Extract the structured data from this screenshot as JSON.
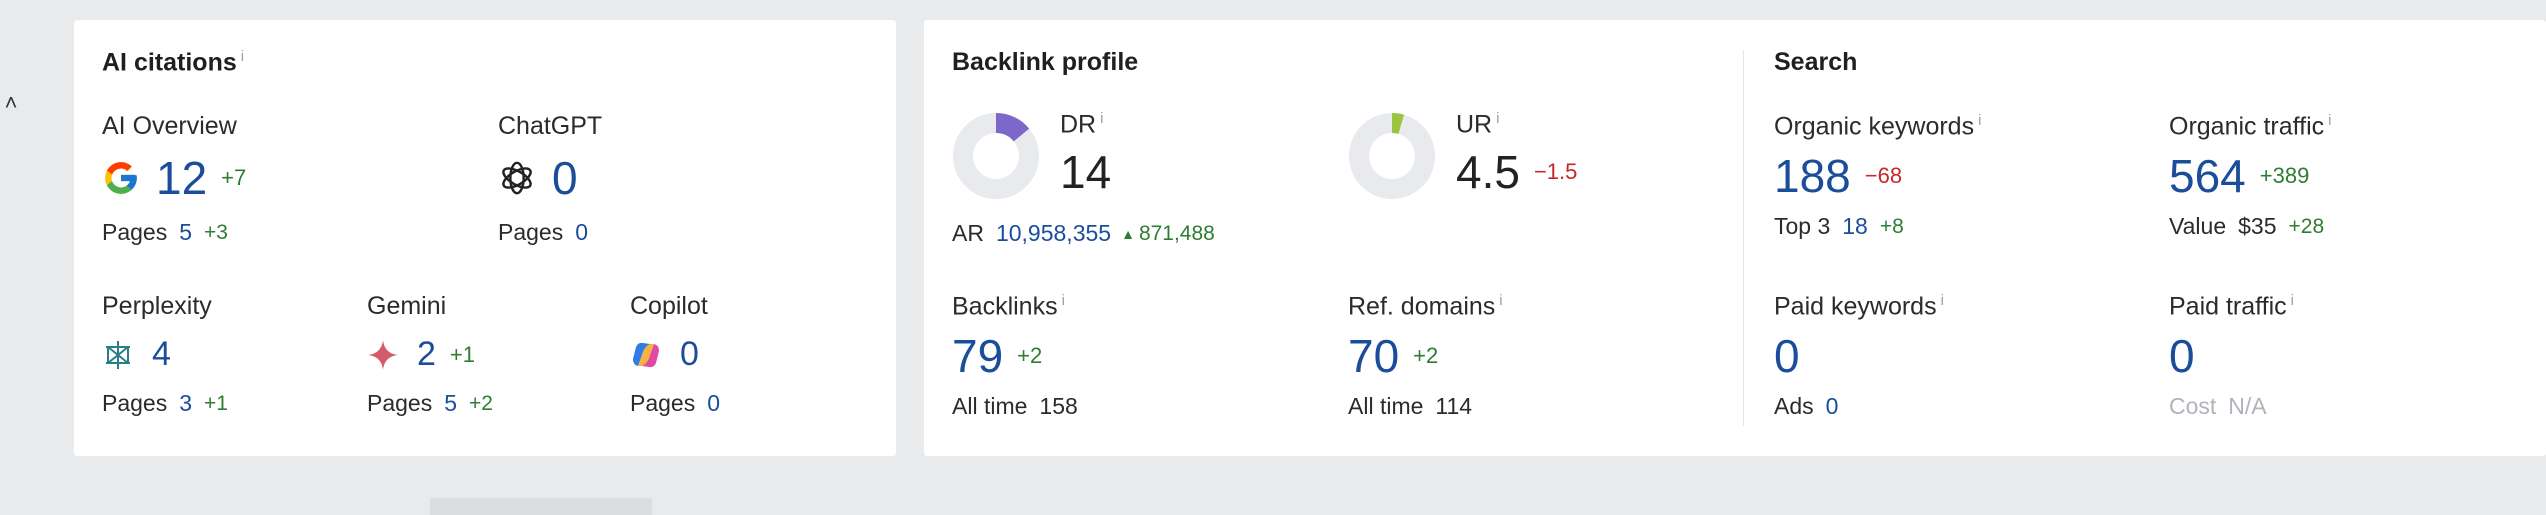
{
  "collapse_icon": "chevron-up-icon",
  "ai_citations": {
    "title": "AI citations",
    "info": "i",
    "ai_overview": {
      "label": "AI Overview",
      "value": "12",
      "delta": "+7",
      "pages_label": "Pages",
      "pages": "5",
      "pages_delta": "+3",
      "icon": "google-icon"
    },
    "chatgpt": {
      "label": "ChatGPT",
      "value": "0",
      "pages_label": "Pages",
      "pages": "0",
      "icon": "openai-icon"
    },
    "perplexity": {
      "label": "Perplexity",
      "value": "4",
      "pages_label": "Pages",
      "pages": "3",
      "pages_delta": "+1",
      "icon": "perplexity-icon"
    },
    "gemini": {
      "label": "Gemini",
      "value": "2",
      "delta": "+1",
      "pages_label": "Pages",
      "pages": "5",
      "pages_delta": "+2",
      "icon": "gemini-icon"
    },
    "copilot": {
      "label": "Copilot",
      "value": "0",
      "pages_label": "Pages",
      "pages": "0",
      "icon": "copilot-icon"
    }
  },
  "backlink_profile": {
    "title": "Backlink profile",
    "dr": {
      "label": "DR",
      "info": "i",
      "value": "14",
      "fill_fraction": 0.14,
      "color": "#7b68c9"
    },
    "ar": {
      "label": "AR",
      "value": "10,958,355",
      "delta": "871,488"
    },
    "ur": {
      "label": "UR",
      "info": "i",
      "value": "4.5",
      "delta": "−1.5",
      "fill_fraction": 0.045,
      "color": "#9bc53d"
    },
    "backlinks": {
      "label": "Backlinks",
      "info": "i",
      "value": "79",
      "delta": "+2",
      "sub_label": "All time",
      "sub_value": "158"
    },
    "ref_domains": {
      "label": "Ref. domains",
      "info": "i",
      "value": "70",
      "delta": "+2",
      "sub_label": "All time",
      "sub_value": "114"
    }
  },
  "search": {
    "title": "Search",
    "organic_keywords": {
      "label": "Organic keywords",
      "info": "i",
      "value": "188",
      "delta": "−68",
      "sub_label": "Top 3",
      "sub_value": "18",
      "sub_delta": "+8"
    },
    "organic_traffic": {
      "label": "Organic traffic",
      "info": "i",
      "value": "564",
      "delta": "+389",
      "sub_label": "Value",
      "sub_value": "$35",
      "sub_delta": "+28"
    },
    "paid_keywords": {
      "label": "Paid keywords",
      "info": "i",
      "value": "0",
      "sub_label": "Ads",
      "sub_value": "0"
    },
    "paid_traffic": {
      "label": "Paid traffic",
      "info": "i",
      "value": "0",
      "sub_label": "Cost",
      "sub_value": "N/A"
    }
  },
  "colors": {
    "value_blue": "#1b4d9b",
    "positive": "#2e7d32",
    "negative": "#c62828",
    "donut_track": "#e8eaed"
  }
}
